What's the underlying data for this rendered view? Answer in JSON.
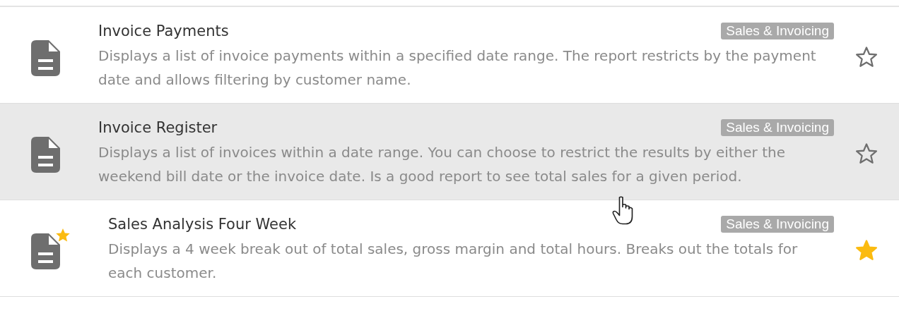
{
  "reports": [
    {
      "title": "Invoice Payments",
      "category": "Sales & Invoicing",
      "description": "Displays a list of invoice payments within a specified date range. The report restricts by the payment date and allows filtering by customer name.",
      "favorite": false,
      "highlighted": false
    },
    {
      "title": "Invoice Register",
      "category": "Sales & Invoicing",
      "description": "Displays a list of invoices within a date range. You can choose to restrict the results by either the weekend bill date or the invoice date. Is a good report to see total sales for a given period.",
      "favorite": false,
      "highlighted": true
    },
    {
      "title": "Sales Analysis Four Week",
      "category": "Sales & Invoicing",
      "description": "Displays a 4 week break out of total sales, gross margin and total hours. Breaks out the totals for each customer.",
      "favorite": true,
      "highlighted": false
    }
  ]
}
